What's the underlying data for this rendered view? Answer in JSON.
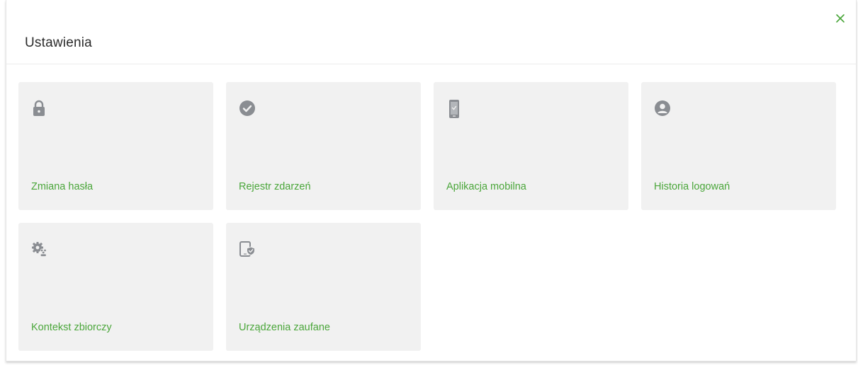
{
  "modal": {
    "title": "Ustawienia"
  },
  "colors": {
    "accent": "#4aa63a",
    "tile_background": "#f1f1f1",
    "icon": "#8a8d92"
  },
  "tiles": [
    {
      "label": "Zmiana hasła",
      "icon": "lock-icon"
    },
    {
      "label": "Rejestr zdarzeń",
      "icon": "check-circle-icon"
    },
    {
      "label": "Aplikacja mobilna",
      "icon": "mobile-phone-icon"
    },
    {
      "label": "Historia logowań",
      "icon": "user-circle-icon"
    },
    {
      "label": "Kontekst zbiorczy",
      "icon": "gear-users-icon"
    },
    {
      "label": "Urządzenia zaufane",
      "icon": "device-shield-icon"
    }
  ]
}
